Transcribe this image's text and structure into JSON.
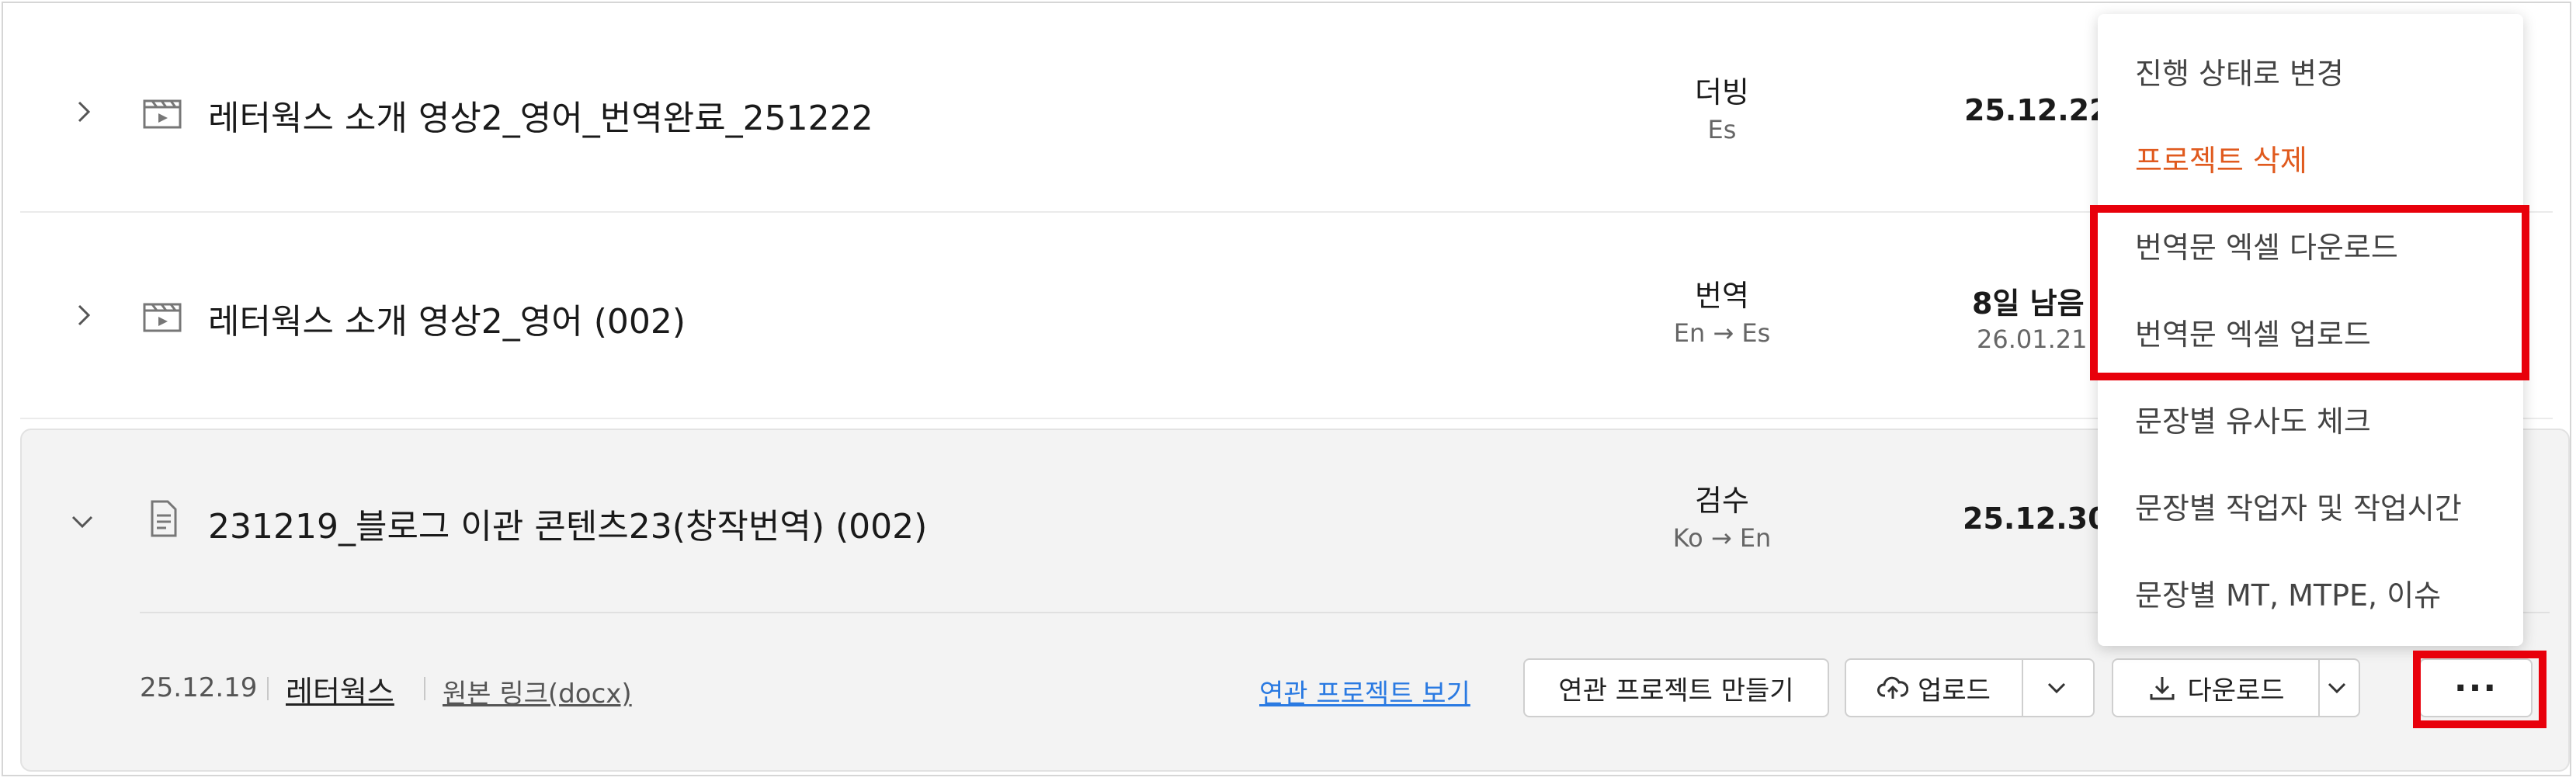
{
  "rows": [
    {
      "title": "레터웍스 소개 영상2_영어_번역완료_251222",
      "task": "더빙",
      "lang": "Es",
      "date": "25.12.22",
      "type_icon": "video-clapper-icon"
    },
    {
      "title": "레터웍스 소개 영상2_영어 (002)",
      "task": "번역",
      "lang": "En → Es",
      "due": "8일 남음",
      "date": "26.01.21",
      "type_icon": "video-clapper-icon"
    },
    {
      "title": "231219_블로그 이관 콘텐츠23(창작번역) (002)",
      "task": "검수",
      "lang": "Ko → En",
      "date": "25.12.30",
      "type_icon": "document-icon"
    }
  ],
  "expanded": {
    "created": "25.12.19",
    "company": "레터웍스",
    "source_link": "원본 링크(docx)",
    "related_view_link": "연관 프로젝트 보기",
    "create_related_button": "연관 프로젝트 만들기",
    "upload_button": "업로드",
    "download_button": "다운로드",
    "more_button": "···"
  },
  "menu": {
    "items": [
      "진행 상태로 변경",
      "프로젝트 삭제",
      "번역문 엑셀 다운로드",
      "번역문 엑셀 업로드",
      "문장별 유사도 체크",
      "문장별 작업자 및 작업시간",
      "문장별 MT, MTPE, 이슈"
    ]
  },
  "colors": {
    "highlight": "#e8000b",
    "danger": "#e05a1e",
    "link": "#2a7ae2"
  }
}
